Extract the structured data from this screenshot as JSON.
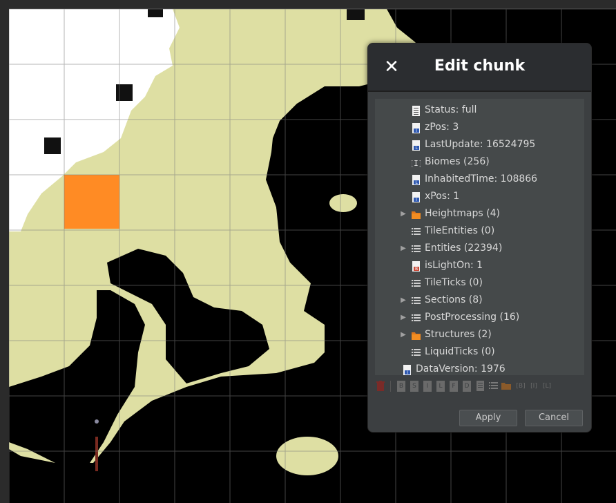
{
  "colors": {
    "land": "#dedfa3",
    "snow": "#ffffff",
    "void": "#000000",
    "selected_chunk": "#ff8b24",
    "grid": "#7a7a7a",
    "dialog_bg": "#3c3f41",
    "header_bg": "#2b2d30",
    "tree_bg": "#45494a"
  },
  "dialog": {
    "title": "Edit chunk",
    "close_icon": "close-icon",
    "apply_label": "Apply",
    "cancel_label": "Cancel"
  },
  "tree": {
    "rows": [
      {
        "label": "Status: full",
        "icon": "string-tag-icon",
        "expandable": false
      },
      {
        "label": "zPos: 3",
        "icon": "int-tag-icon",
        "expandable": false
      },
      {
        "label": "LastUpdate: 16524795",
        "icon": "long-tag-icon",
        "expandable": false
      },
      {
        "label": "Biomes (256)",
        "icon": "int-array-icon",
        "expandable": false
      },
      {
        "label": "InhabitedTime: 108866",
        "icon": "long-tag-icon",
        "expandable": false
      },
      {
        "label": "xPos: 1",
        "icon": "int-tag-icon",
        "expandable": false
      },
      {
        "label": "Heightmaps (4)",
        "icon": "folder-icon",
        "expandable": true
      },
      {
        "label": "TileEntities (0)",
        "icon": "list-icon",
        "expandable": false
      },
      {
        "label": "Entities (22394)",
        "icon": "list-icon",
        "expandable": true
      },
      {
        "label": "isLightOn: 1",
        "icon": "byte-tag-icon",
        "expandable": false
      },
      {
        "label": "TileTicks (0)",
        "icon": "list-icon",
        "expandable": false
      },
      {
        "label": "Sections (8)",
        "icon": "list-icon",
        "expandable": true
      },
      {
        "label": "PostProcessing (16)",
        "icon": "list-icon",
        "expandable": true
      },
      {
        "label": "Structures (2)",
        "icon": "folder-icon",
        "expandable": true
      },
      {
        "label": "LiquidTicks (0)",
        "icon": "list-icon",
        "expandable": false
      },
      {
        "label": "DataVersion: 1976",
        "icon": "int-tag-icon",
        "expandable": false
      }
    ]
  },
  "toolbar": {
    "items": [
      {
        "name": "delete-icon",
        "glyph": ""
      },
      {
        "name": "byte-tag-icon",
        "glyph": "B"
      },
      {
        "name": "short-tag-icon",
        "glyph": "S"
      },
      {
        "name": "int-tag-icon",
        "glyph": "I"
      },
      {
        "name": "long-tag-icon",
        "glyph": "L"
      },
      {
        "name": "float-tag-icon",
        "glyph": "F"
      },
      {
        "name": "double-tag-icon",
        "glyph": "D"
      },
      {
        "name": "string-tag-icon",
        "glyph": ""
      },
      {
        "name": "list-icon",
        "glyph": ""
      },
      {
        "name": "compound-folder-icon",
        "glyph": ""
      },
      {
        "name": "byte-array-icon",
        "glyph": "[B]"
      },
      {
        "name": "int-array-icon",
        "glyph": "[I]"
      },
      {
        "name": "long-array-icon",
        "glyph": "[L]"
      }
    ]
  }
}
